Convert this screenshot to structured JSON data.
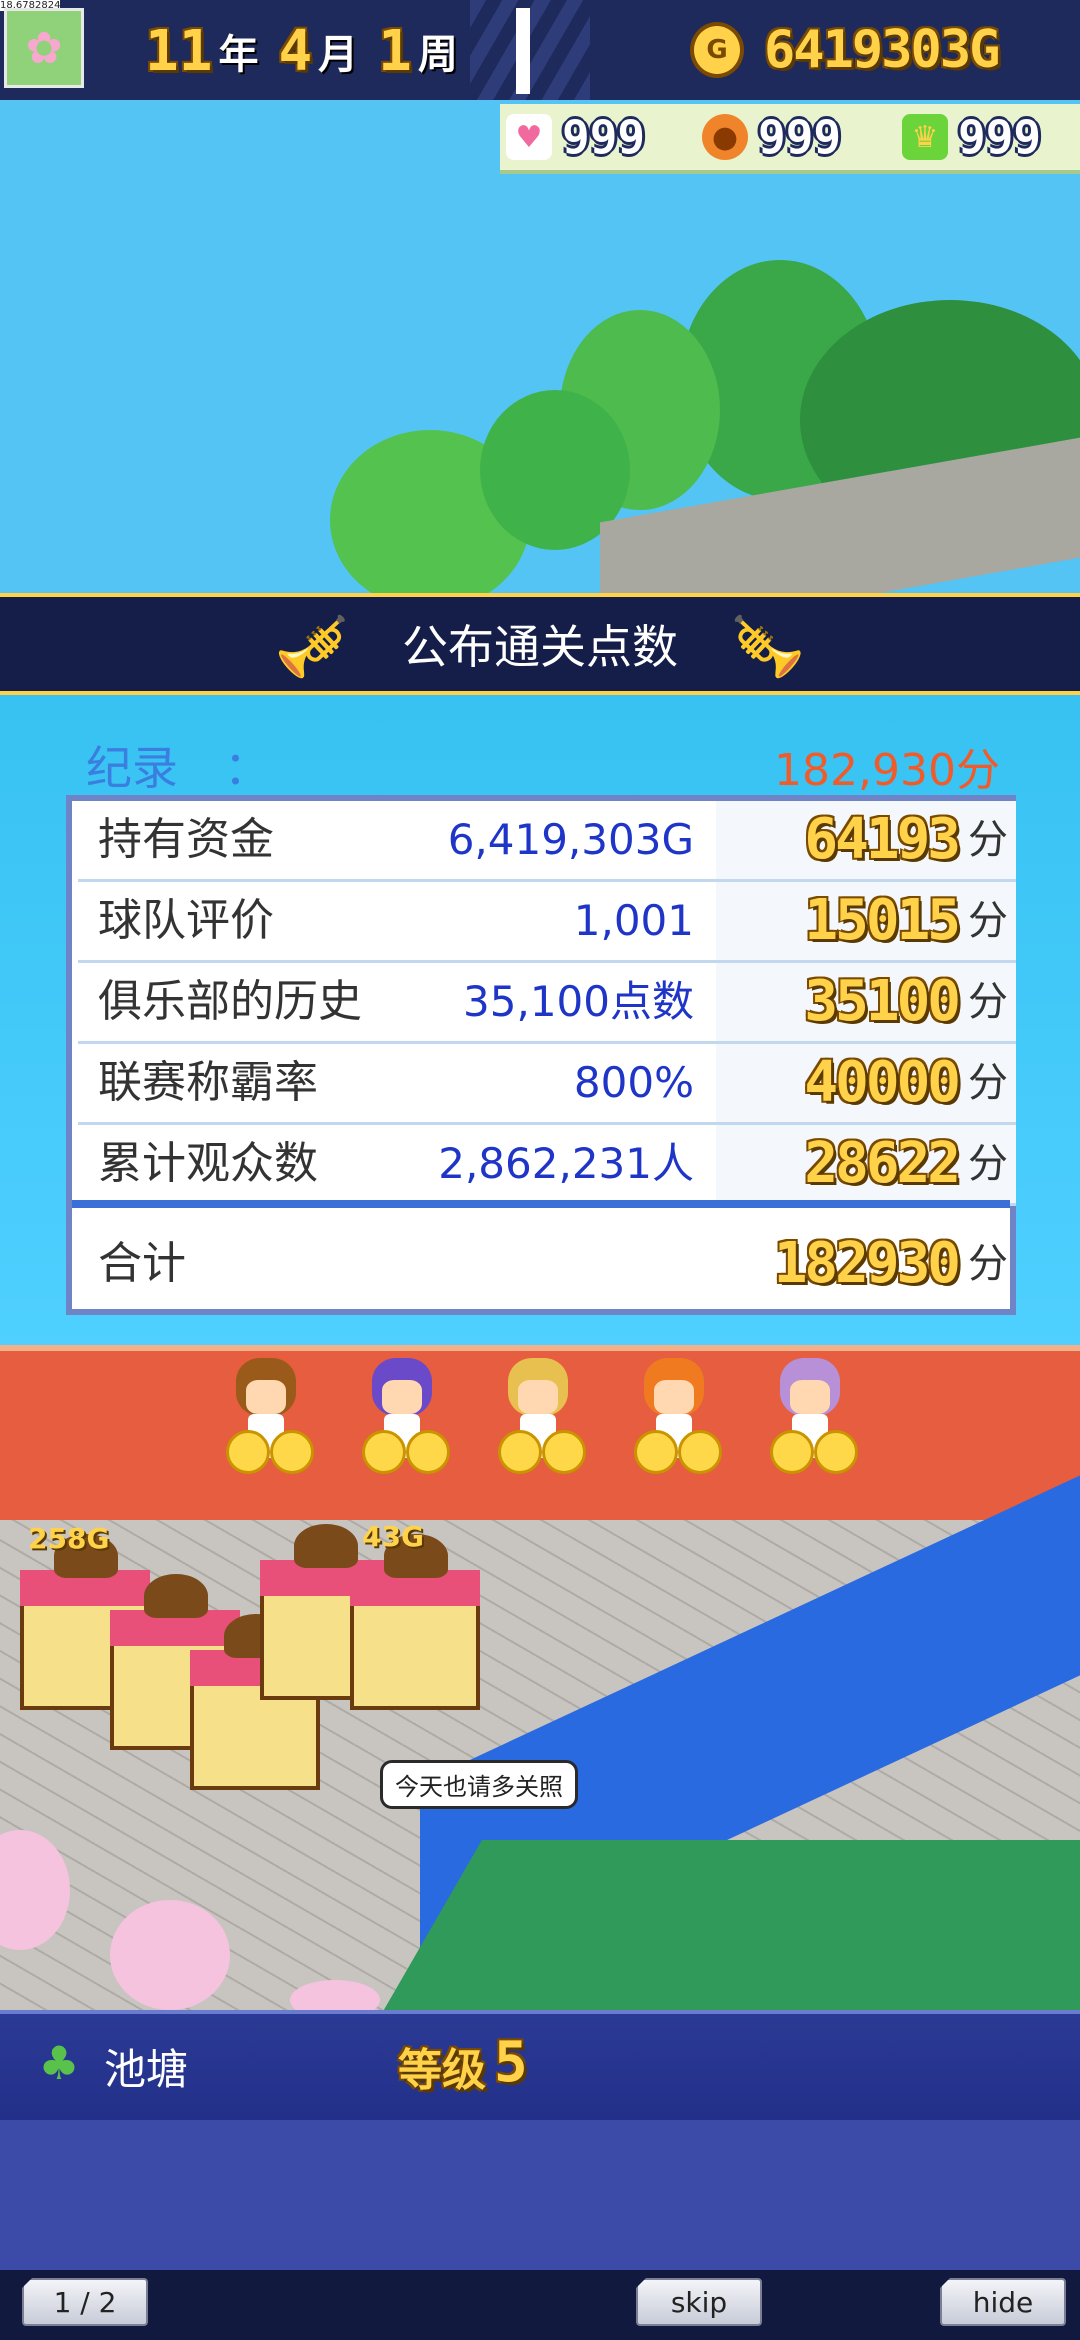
{
  "debug": {
    "corner_text": "18.6782824"
  },
  "header": {
    "year_num": "11",
    "year_unit": "年",
    "month_num": "4",
    "month_unit": "月",
    "week_num": "1",
    "week_unit": "周",
    "money": "6419303G"
  },
  "stats": {
    "heart": "999",
    "ball": "999",
    "trophy": "999"
  },
  "banner": {
    "title": "公布通关点数"
  },
  "record": {
    "label": "纪录　：",
    "value": "182,930分"
  },
  "score_rows": [
    {
      "label": "持有资金",
      "value": "6,419,303G",
      "points": "64193",
      "unit": "分"
    },
    {
      "label": "球队评价",
      "value": "1,001",
      "points": "15015",
      "unit": "分"
    },
    {
      "label": "俱乐部的历史",
      "value": "35,100点数",
      "points": "35100",
      "unit": "分"
    },
    {
      "label": "联赛称霸率",
      "value": "800%",
      "points": "40000",
      "unit": "分"
    },
    {
      "label": "累计观众数",
      "value": "2,862,231人",
      "points": "28622",
      "unit": "分"
    }
  ],
  "total": {
    "label": "合计",
    "points": "182930",
    "unit": "分"
  },
  "town": {
    "shop_price_1": "258G",
    "shop_price_2": "43G",
    "speech": "今天也请多关照"
  },
  "facility": {
    "name": "池塘",
    "level_label": "等级",
    "level_value": "5"
  },
  "footer": {
    "page": "1 / 2",
    "skip": "skip",
    "hide": "hide"
  },
  "colors": {
    "accent_gold": "#ffd24a",
    "record_value": "#f15b2a",
    "value_blue": "#1e35c8"
  },
  "icons": [
    "flower-icon",
    "gold-coin-icon",
    "heart-icon",
    "basketball-icon",
    "trophy-icon",
    "trumpet-icon",
    "pond-icon"
  ]
}
